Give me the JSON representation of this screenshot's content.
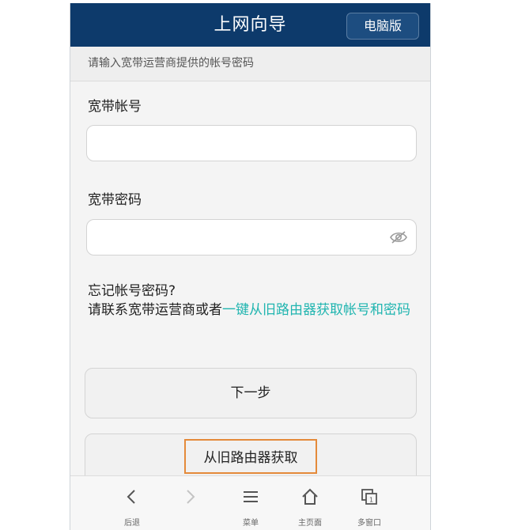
{
  "header": {
    "title": "上网向导",
    "pc_button": "电脑版"
  },
  "hint": "请输入宽带运营商提供的帐号密码",
  "account": {
    "label": "宽带帐号",
    "value": "",
    "placeholder": ""
  },
  "password": {
    "label": "宽带密码",
    "value": "",
    "placeholder": ""
  },
  "forgot": {
    "question": "忘记帐号密码?",
    "prefix": "请联系宽带运营商或者",
    "link": "一键从旧路由器获取帐号和密码"
  },
  "buttons": {
    "next": "下一步",
    "fetch": "从旧路由器获取"
  },
  "bottom_nav": [
    {
      "label": "后退",
      "icon": "back-arrow-icon"
    },
    {
      "label": "",
      "icon": "forward-arrow-icon"
    },
    {
      "label": "菜单",
      "icon": "menu-icon"
    },
    {
      "label": "主页面",
      "icon": "home-icon"
    },
    {
      "label": "多窗口",
      "icon": "windows-icon"
    }
  ],
  "colors": {
    "header_bg": "#0d3a6b",
    "link": "#21b5b0",
    "highlight_border": "#e48a3a"
  }
}
